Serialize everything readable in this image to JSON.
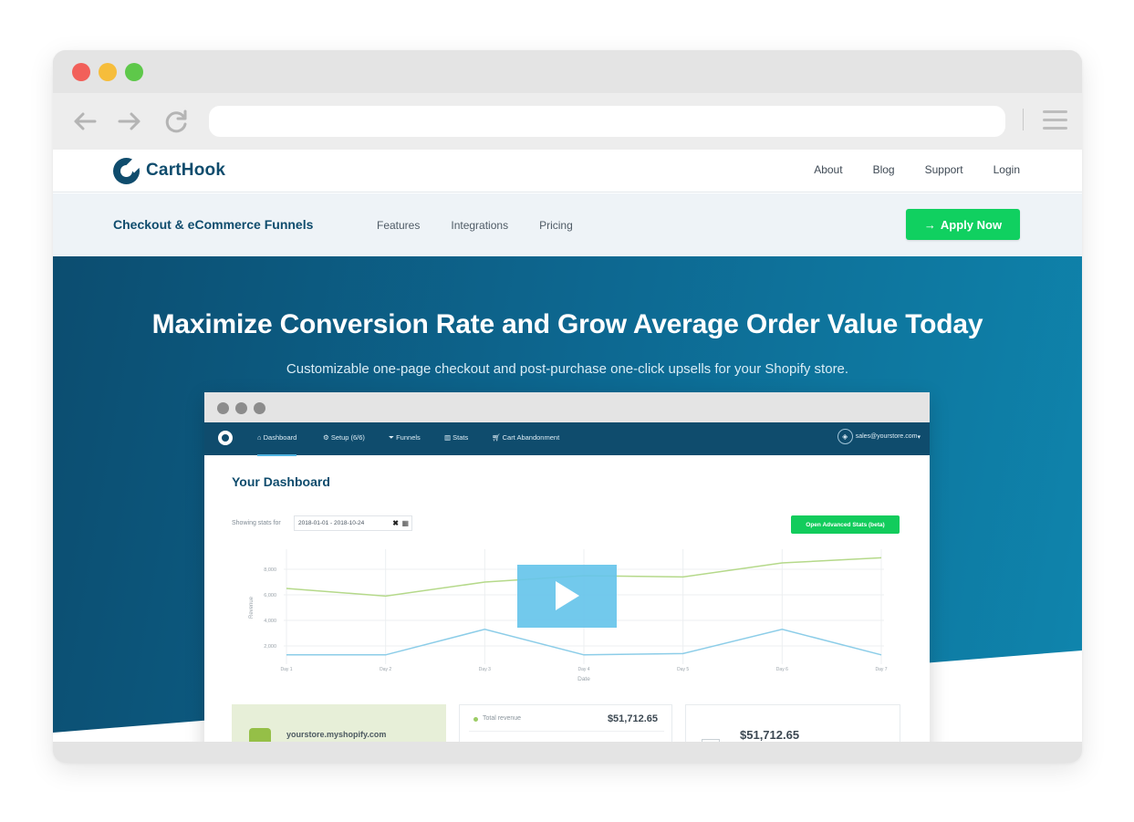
{
  "brand": {
    "name": "CartHook",
    "color": "#0f4c6d"
  },
  "top_nav": [
    "About",
    "Blog",
    "Support",
    "Login"
  ],
  "product_nav": {
    "title": "Checkout & eCommerce Funnels",
    "links": [
      "Features",
      "Integrations",
      "Pricing"
    ],
    "cta": "Apply Now",
    "cta_color": "#10d060"
  },
  "hero": {
    "title": "Maximize Conversion Rate and Grow Average Order Value Today",
    "subtitle": "Customizable one-page checkout and post-purchase one-click upsells for your Shopify store."
  },
  "dashboard": {
    "nav": [
      "Dashboard",
      "Setup (6/6)",
      "Funnels",
      "Stats",
      "Cart Abandonment"
    ],
    "user": "sales@yourstore.com",
    "title": "Your Dashboard",
    "stats_label": "Showing stats for",
    "date_range": "2018-01-01 - 2018-10-24",
    "advanced_button": "Open Advanced Stats (beta)",
    "store": "yourstore.myshopify.com",
    "revenue_label": "Total revenue",
    "revenue_value": "$51,712.65",
    "total_value": "$51,712.65"
  },
  "chart_data": {
    "type": "line",
    "x": [
      "Day 1",
      "Day 2",
      "Day 3",
      "Day 4",
      "Day 5",
      "Day 6",
      "Day 7"
    ],
    "ylabel": "Revenue",
    "xlabel": "Date",
    "yticks": [
      "2,000",
      "4,000",
      "6,000",
      "8,000"
    ],
    "ylim": [
      1000,
      9000
    ],
    "grid": true,
    "series": [
      {
        "values": [
          6500,
          5900,
          7000,
          7500,
          7400,
          8500,
          8900
        ],
        "color": "#b5d98a"
      },
      {
        "values": [
          1300,
          1300,
          3300,
          1300,
          1400,
          3300,
          1300
        ],
        "color": "#8ccde8"
      }
    ]
  }
}
